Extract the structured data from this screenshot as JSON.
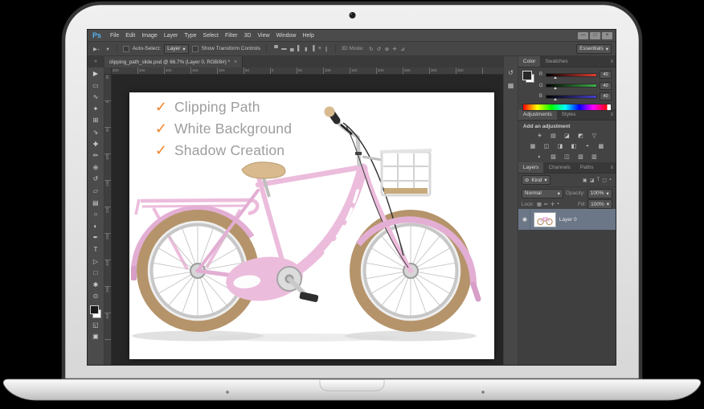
{
  "icons": {
    "caret": "▾",
    "panel_menu": "≡",
    "tab_close": "×",
    "toolbar_overflow": "»",
    "eye": "◉",
    "kind_search": "⊘",
    "move_options": "▶₊",
    "check": "✓"
  },
  "menubar": {
    "logo": "Ps",
    "items": [
      "File",
      "Edit",
      "Image",
      "Layer",
      "Type",
      "Select",
      "Filter",
      "3D",
      "View",
      "Window",
      "Help"
    ],
    "window_buttons": [
      {
        "name": "minimize-button",
        "glyph": "—"
      },
      {
        "name": "restore-button",
        "glyph": "□"
      },
      {
        "name": "close-button",
        "glyph": "×"
      }
    ]
  },
  "options": {
    "auto_select_label": "Auto-Select:",
    "target_value": "Layer",
    "show_transform_label": "Show Transform Controls",
    "mode3d_label": "3D Mode:",
    "workspace": "Essentials",
    "align_icons": [
      {
        "name": "align-top-edges-icon",
        "glyph": "▀"
      },
      {
        "name": "align-vertical-centers-icon",
        "glyph": "▬"
      },
      {
        "name": "align-bottom-edges-icon",
        "glyph": "▄"
      },
      {
        "name": "align-left-edges-icon",
        "glyph": "▌"
      },
      {
        "name": "align-horizontal-centers-icon",
        "glyph": "▮"
      },
      {
        "name": "align-right-edges-icon",
        "glyph": "▐"
      },
      {
        "name": "distribute-top-edges-icon",
        "glyph": "≡"
      },
      {
        "name": "distribute-vertical-centers-icon",
        "glyph": "∥"
      }
    ],
    "mode3d_icons": [
      {
        "name": "3d-rotate-icon",
        "glyph": "↻"
      },
      {
        "name": "3d-roll-icon",
        "glyph": "↺"
      },
      {
        "name": "3d-drag-icon",
        "glyph": "⊕"
      },
      {
        "name": "3d-slide-icon",
        "glyph": "✛"
      },
      {
        "name": "3d-scale-icon",
        "glyph": "⊿"
      }
    ]
  },
  "document_tab": {
    "title": "clipping_path_slide.psd @ 66.7% (Layer 0, RGB/8#) *"
  },
  "ruler": {
    "h_labels": [
      "300",
      "250",
      "200",
      "150",
      "100",
      "50",
      "0",
      "50",
      "100",
      "150",
      "200",
      "250",
      "300",
      "350",
      "400"
    ],
    "v_labels": [
      "50",
      "0",
      "50",
      "100",
      "150",
      "200",
      "250",
      "300",
      "350",
      "400"
    ]
  },
  "tools": [
    {
      "name": "move-tool-icon",
      "glyph": "▶"
    },
    {
      "name": "rectangular-marquee-tool-icon",
      "glyph": "▭"
    },
    {
      "name": "lasso-tool-icon",
      "glyph": "∿"
    },
    {
      "name": "quick-selection-tool-icon",
      "glyph": "✦"
    },
    {
      "name": "crop-tool-icon",
      "glyph": "⊞"
    },
    {
      "name": "eyedropper-tool-icon",
      "glyph": "⇘"
    },
    {
      "name": "spot-healing-brush-tool-icon",
      "glyph": "✚"
    },
    {
      "name": "brush-tool-icon",
      "glyph": "✏"
    },
    {
      "name": "clone-stamp-tool-icon",
      "glyph": "⊕"
    },
    {
      "name": "history-brush-tool-icon",
      "glyph": "↺"
    },
    {
      "name": "eraser-tool-icon",
      "glyph": "▱"
    },
    {
      "name": "gradient-tool-icon",
      "glyph": "▤"
    },
    {
      "name": "blur-tool-icon",
      "glyph": "○"
    },
    {
      "name": "dodge-tool-icon",
      "glyph": "◐"
    },
    {
      "name": "pen-tool-icon",
      "glyph": "✒"
    },
    {
      "name": "type-tool-icon",
      "glyph": "T"
    },
    {
      "name": "path-selection-tool-icon",
      "glyph": "▷"
    },
    {
      "name": "rectangle-tool-icon",
      "glyph": "□"
    },
    {
      "name": "hand-tool-icon",
      "glyph": "✱"
    },
    {
      "name": "zoom-tool-icon",
      "glyph": "⊙"
    }
  ],
  "tools_bottom": [
    {
      "name": "quick-mask-icon",
      "glyph": "◱"
    },
    {
      "name": "screen-mode-icon",
      "glyph": "▣"
    }
  ],
  "dock_icons": [
    {
      "name": "history-panel-icon",
      "glyph": "↺"
    },
    {
      "name": "properties-panel-icon",
      "glyph": "▦"
    }
  ],
  "panels": {
    "color": {
      "tab_color": "Color",
      "tab_swatches": "Swatches",
      "sliders": {
        "r_label": "R",
        "g_label": "G",
        "b_label": "B",
        "r_value": "40",
        "g_value": "40",
        "b_value": "40"
      }
    },
    "adjustments": {
      "tab_adjustments": "Adjustments",
      "tab_styles": "Styles",
      "heading": "Add an adjustment",
      "row1": [
        {
          "name": "brightness-contrast-adjustment-icon",
          "glyph": "☀"
        },
        {
          "name": "levels-adjustment-icon",
          "glyph": "▤"
        },
        {
          "name": "curves-adjustment-icon",
          "glyph": "◪"
        },
        {
          "name": "exposure-adjustment-icon",
          "glyph": "◩"
        },
        {
          "name": "vibrance-adjustment-icon",
          "glyph": "▽"
        }
      ],
      "row2": [
        {
          "name": "hue-saturation-adjustment-icon",
          "glyph": "▦"
        },
        {
          "name": "color-balance-adjustment-icon",
          "glyph": "◫"
        },
        {
          "name": "black-white-adjustment-icon",
          "glyph": "◨"
        },
        {
          "name": "photo-filter-adjustment-icon",
          "glyph": "◧"
        },
        {
          "name": "channel-mixer-adjustment-icon",
          "glyph": "◓"
        },
        {
          "name": "color-lookup-adjustment-icon",
          "glyph": "▩"
        }
      ],
      "row3": [
        {
          "name": "invert-adjustment-icon",
          "glyph": "◐"
        },
        {
          "name": "posterize-adjustment-icon",
          "glyph": "▨"
        },
        {
          "name": "threshold-adjustment-icon",
          "glyph": "◫"
        },
        {
          "name": "gradient-map-adjustment-icon",
          "glyph": "▧"
        },
        {
          "name": "selective-color-adjustment-icon",
          "glyph": "▥"
        }
      ]
    },
    "layers": {
      "tab_layers": "Layers",
      "tab_channels": "Channels",
      "tab_paths": "Paths",
      "kind_label": "Kind",
      "filter_icons": [
        {
          "name": "filter-pixel-layers-icon",
          "glyph": "▣"
        },
        {
          "name": "filter-adjustment-layers-icon",
          "glyph": "◪"
        },
        {
          "name": "filter-type-layers-icon",
          "glyph": "T"
        },
        {
          "name": "filter-shape-layers-icon",
          "glyph": "▢"
        },
        {
          "name": "filter-smart-objects-icon",
          "glyph": "▪"
        }
      ],
      "blend_mode": "Normal",
      "opacity_label": "Opacity:",
      "opacity_value": "100%",
      "lock_label": "Lock:",
      "lock_icons": [
        {
          "name": "lock-transparent-pixels-icon",
          "glyph": "▦"
        },
        {
          "name": "lock-image-pixels-icon",
          "glyph": "✏"
        },
        {
          "name": "lock-position-icon",
          "glyph": "✛"
        },
        {
          "name": "lock-all-icon",
          "glyph": "▪"
        }
      ],
      "fill_label": "Fill:",
      "fill_value": "100%",
      "layer_name": "Layer 0"
    }
  },
  "canvas": {
    "checklist": [
      "Clipping Path",
      "White Background",
      "Shadow Creation"
    ],
    "check_color": "#f0862c",
    "text_color": "#9d9d9d",
    "bike_pink": "#ecbcdc",
    "tire_tan": "#b5946b"
  }
}
